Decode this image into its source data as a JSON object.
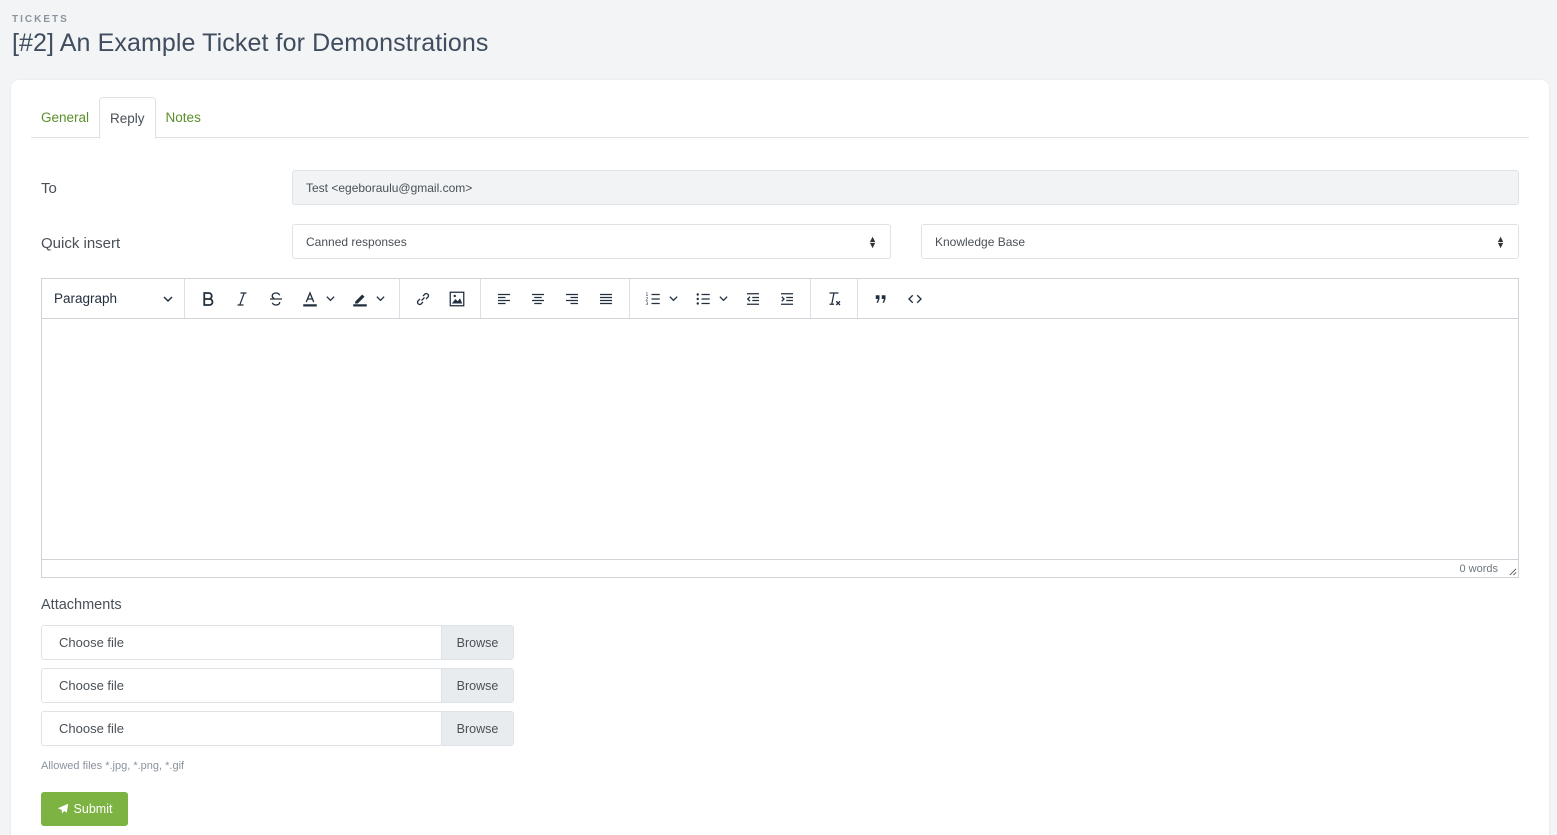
{
  "header": {
    "section": "TICKETS",
    "title": "[#2] An Example Ticket for Demonstrations"
  },
  "tabs": [
    {
      "label": "General",
      "active": false
    },
    {
      "label": "Reply",
      "active": true
    },
    {
      "label": "Notes",
      "active": false
    }
  ],
  "form": {
    "to_label": "To",
    "to_value": "Test <egeboraulu@gmail.com>",
    "quick_insert_label": "Quick insert",
    "canned_responses": "Canned responses",
    "knowledge_base": "Knowledge Base"
  },
  "editor": {
    "block_format": "Paragraph",
    "word_count": "0 words",
    "toolbar_icons": [
      "bold-icon",
      "italic-icon",
      "strikethrough-icon",
      "text-color-icon",
      "highlight-icon",
      "link-icon",
      "image-icon",
      "align-left-icon",
      "align-center-icon",
      "align-right-icon",
      "align-justify-icon",
      "numbered-list-icon",
      "bullet-list-icon",
      "outdent-icon",
      "indent-icon",
      "clear-formatting-icon",
      "blockquote-icon",
      "code-icon"
    ]
  },
  "attachments": {
    "label": "Attachments",
    "files": [
      {
        "placeholder": "Choose file",
        "button": "Browse"
      },
      {
        "placeholder": "Choose file",
        "button": "Browse"
      },
      {
        "placeholder": "Choose file",
        "button": "Browse"
      }
    ],
    "allowed": "Allowed files *.jpg, *.png, *.gif"
  },
  "submit_label": "Submit",
  "colors": {
    "accent": "#7cb342",
    "tab_link": "#5a8f29",
    "background": "#f3f4f6"
  }
}
